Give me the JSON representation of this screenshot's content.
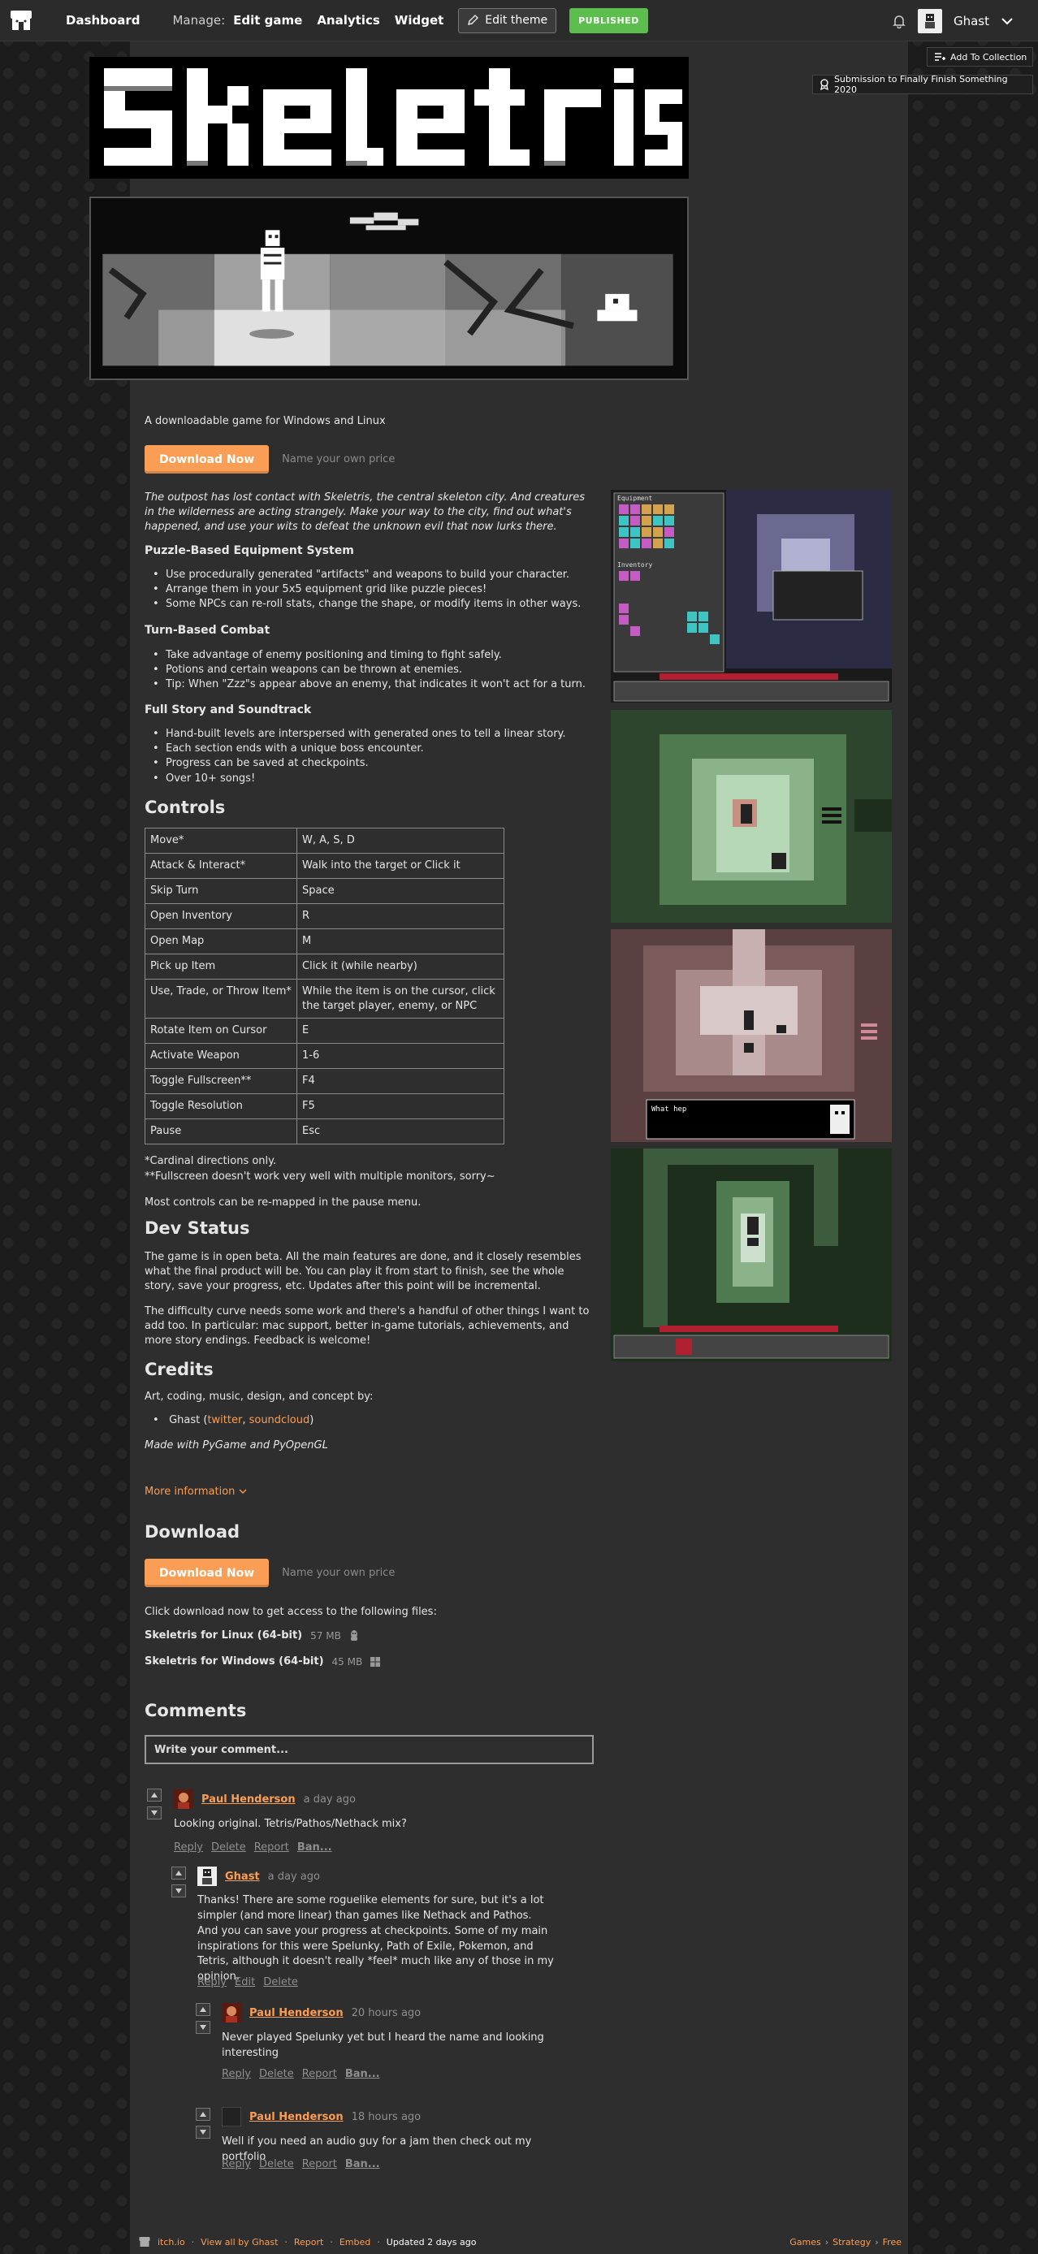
{
  "topbar": {
    "dashboard": "Dashboard",
    "manage": "Manage:",
    "edit_game": "Edit game",
    "analytics": "Analytics",
    "widget": "Widget",
    "edit_theme": "Edit theme",
    "published": "PUBLISHED",
    "user_name": "Ghast"
  },
  "collection_button": "Add To Collection",
  "jam_badge": "Submission to Finally Finish Something 2020",
  "game": {
    "tagline": "A downloadable game for Windows and Linux",
    "download_label": "Download Now",
    "price_placeholder": "Name your own price",
    "intro": "The outpost has lost contact with Skeletris, the central skeleton city. And creatures in the wilderness are acting strangely. Make your way to the city, find out what's happened, and use your wits to defeat the unknown evil that now lurks there.",
    "sections": [
      {
        "title": "Puzzle-Based Equipment System",
        "items": [
          "Use procedurally generated \"artifacts\" and weapons to build your character.",
          "Arrange them in your 5x5 equipment grid like puzzle pieces!",
          "Some NPCs can re-roll stats, change the shape, or modify items in other ways."
        ]
      },
      {
        "title": "Turn-Based Combat",
        "items": [
          "Take advantage of enemy positioning and timing to fight safely.",
          "Potions and certain weapons can be thrown at enemies.",
          "Tip: When \"Zzz\"s appear above an enemy, that indicates it won't act for a turn."
        ]
      },
      {
        "title": "Full Story and Soundtrack",
        "items": [
          "Hand-built levels are interspersed with generated ones to tell a linear story.",
          "Each section ends with a unique boss encounter.",
          "Progress can be saved at checkpoints.",
          "Over 10+ songs!"
        ]
      }
    ],
    "controls_heading": "Controls",
    "controls": [
      [
        "Move*",
        "W, A, S, D"
      ],
      [
        "Attack & Interact*",
        "Walk into the target or Click it"
      ],
      [
        "Skip Turn",
        "Space"
      ],
      [
        "Open Inventory",
        "R"
      ],
      [
        "Open Map",
        "M"
      ],
      [
        "Pick up Item",
        "Click it (while nearby)"
      ],
      [
        "Use, Trade, or Throw Item*",
        "While the item is on the cursor, click the target player, enemy, or NPC"
      ],
      [
        "Rotate Item on Cursor",
        "E"
      ],
      [
        "Activate Weapon",
        "1-6"
      ],
      [
        "Toggle Fullscreen**",
        "F4"
      ],
      [
        "Toggle Resolution",
        "F5"
      ],
      [
        "Pause",
        "Esc"
      ]
    ],
    "footnote1": "*Cardinal directions only.",
    "footnote2": "**Fullscreen doesn't work very well with multiple monitors, sorry~",
    "remap_note": "Most controls can be re-mapped in the pause menu.",
    "dev_heading": "Dev Status",
    "dev_p1": "The game is in open beta. All the main features are done, and it closely resembles what the final product will be. You can play it from start to finish, see the whole story, save your progress, etc. Updates after this point will be incremental.",
    "dev_p2": "The difficulty curve needs some work and there's a handful of other things I want to add too. In particular: mac support, better in-game tutorials, achievements, and more story endings. Feedback is welcome!",
    "credits_heading": "Credits",
    "credits_intro": "Art, coding, music, design, and concept by:",
    "credit_name": "Ghast (",
    "credit_twitter": "twitter",
    "credit_sep": ", ",
    "credit_soundcloud": "soundcloud",
    "credit_end": ")",
    "made_with": "Made with PyGame and PyOpenGL",
    "more_info": "More information",
    "download_heading": "Download",
    "download_intro": "Click download now to get access to the following files:",
    "files": [
      {
        "name": "Skeletris for Linux (64-bit)",
        "size": "57 MB",
        "icon": "linux-icon"
      },
      {
        "name": "Skeletris for Windows (64-bit)",
        "size": "45 MB",
        "icon": "windows-icon"
      }
    ]
  },
  "screenshot_texts": {
    "equipment": "Equipment",
    "inventory": "Inventory",
    "what_hep": "What hep"
  },
  "comments": {
    "heading": "Comments",
    "placeholder": "Write your comment...",
    "list": [
      {
        "author": "Paul Henderson",
        "time": "a day ago",
        "body": "Looking original. Tetris/Pathos/Nethack mix?",
        "actions": [
          "Reply",
          "Delete",
          "Report",
          "Ban..."
        ]
      },
      {
        "author": "Ghast",
        "time": "a day ago",
        "body": "Thanks! There are some roguelike elements for sure, but it's a lot simpler (and more linear) than games like Nethack and Pathos. And you can save your progress at checkpoints. Some of my main inspirations for this were Spelunky, Path of Exile, Pokemon, and Tetris, although it doesn't really *feel* much like any of those in my opinion.",
        "actions": [
          "Reply",
          "Edit",
          "Delete"
        ]
      },
      {
        "author": "Paul Henderson",
        "time": "20 hours ago",
        "body": "Never played Spelunky yet but I heard the name and looking interesting",
        "actions": [
          "Reply",
          "Delete",
          "Report",
          "Ban..."
        ]
      },
      {
        "author": "Paul Henderson",
        "time": "18 hours ago",
        "body": "Well if you need an audio guy for a jam then check out my portfolio",
        "actions": [
          "Reply",
          "Delete",
          "Report",
          "Ban..."
        ]
      }
    ]
  },
  "footer": {
    "itchio": "itch.io",
    "view_all": "View all by Ghast",
    "report": "Report",
    "embed": "Embed",
    "updated": "Updated 2 days ago",
    "tags": [
      "Games",
      "Strategy",
      "Free"
    ]
  },
  "colors": {
    "accent": "#fa9e55",
    "published": "#5cbe4d",
    "page_bg": "#2e2e2e"
  }
}
